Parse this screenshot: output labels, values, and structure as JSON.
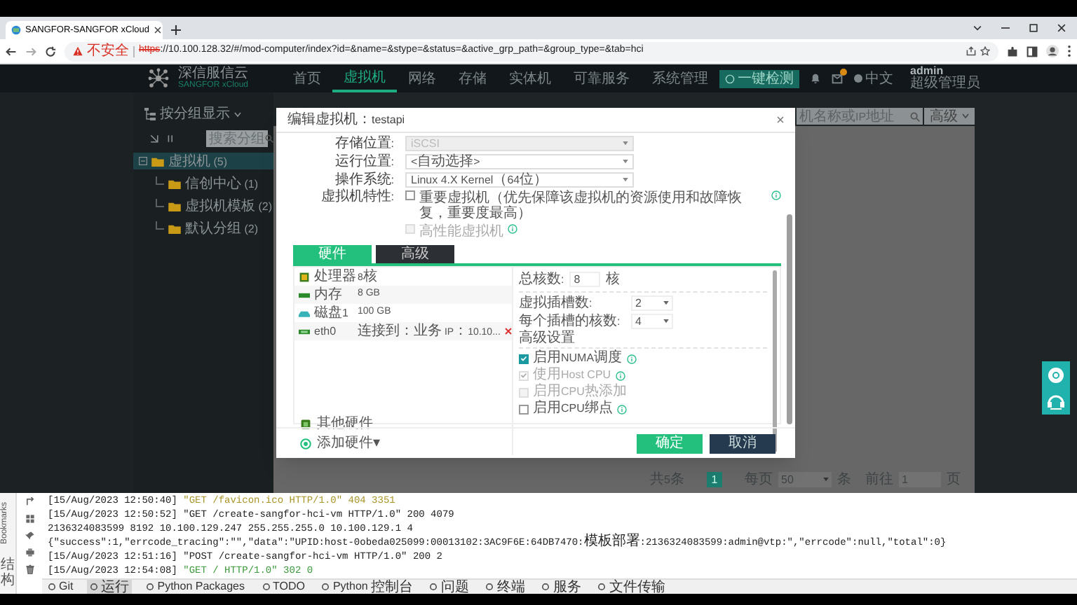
{
  "browser": {
    "tab_title": "SANGFOR-SANGFOR xCloud",
    "insecure_label": "不安全",
    "url_scheme": "https",
    "url_rest": "://10.100.128.32/#/mod-computer/index?id=&name=&stype=&status=&active_grp_path=&group_type=&tab=hci"
  },
  "header": {
    "brand": "深信服信云",
    "brand_sub": "SANGFOR xCloud",
    "nav": [
      {
        "label": "首页",
        "selected": false
      },
      {
        "label": "虚拟机",
        "selected": true
      },
      {
        "label": "网络",
        "selected": false
      },
      {
        "label": "存储",
        "selected": false
      },
      {
        "label": "实体机",
        "selected": false
      },
      {
        "label": "可靠服务",
        "selected": false
      },
      {
        "label": "系统管理",
        "selected": false
      }
    ],
    "check_button": "一键检测",
    "language": "中文",
    "user": "admin",
    "role": "超级管理员"
  },
  "sidebar": {
    "group_toggle": "按分组显示",
    "search_placeholder": "搜索分组",
    "tree": [
      {
        "label": "虚拟机 (5)",
        "selected": true,
        "expanded": true,
        "children": [
          {
            "label": "信创中心 (1)",
            "selected": false
          },
          {
            "label": "虚拟机模板 (2)",
            "selected": false
          },
          {
            "label": "默认分组 (2)",
            "selected": false
          }
        ]
      }
    ]
  },
  "toolbar": {
    "search_placeholder": "机名称或IP地址",
    "advanced": "高级"
  },
  "pagination": {
    "total": "共5条",
    "current": "1",
    "per_page_label": "每页",
    "per_page": "50",
    "per_page_unit": "条",
    "goto_label": "前往",
    "goto_value": "1",
    "goto_unit": "页"
  },
  "dialog": {
    "title": "编辑虚拟机：testapi",
    "fields": [
      {
        "label": "存储位置:",
        "value": "iSCSI",
        "disabled": true
      },
      {
        "label": "运行位置:",
        "value": "<自动选择>",
        "disabled": false
      },
      {
        "label": "操作系统:",
        "value": "Linux 4.X Kernel（64位）",
        "disabled": false
      }
    ],
    "features_label": "虚拟机特性:",
    "features": [
      {
        "label": "重要虚拟机（优先保障该虚拟机的资源使用和故障恢复，重要度最高）",
        "checked": false,
        "disabled": false,
        "info": true
      },
      {
        "label": "高性能虚拟机",
        "checked": false,
        "disabled": true,
        "info": true
      }
    ],
    "tabs": [
      {
        "label": "硬件",
        "selected": true
      },
      {
        "label": "高级",
        "selected": false
      }
    ],
    "hardware": [
      {
        "kind": "cpu",
        "name": "处理器",
        "value": "8核",
        "removable": false
      },
      {
        "kind": "memory",
        "name": "内存",
        "value": "8 GB",
        "removable": false
      },
      {
        "kind": "disk",
        "name": "磁盘1",
        "value": "100 GB",
        "removable": false
      },
      {
        "kind": "nic",
        "name": "eth0",
        "value": "连接到：业务 IP：10.10...",
        "removable": true
      }
    ],
    "extras": [
      {
        "kind": "other",
        "label": "其他硬件"
      },
      {
        "kind": "add",
        "label": "添加硬件▾"
      }
    ],
    "cpu": {
      "total_label": "总核数:",
      "total": "8",
      "total_unit": "核",
      "selects": [
        {
          "label": "虚拟插槽数:",
          "value": "2"
        },
        {
          "label": "每个插槽的核数:",
          "value": "4"
        }
      ],
      "advanced_title": "高级设置",
      "options": [
        {
          "label": "启用NUMA调度",
          "checked": true,
          "disabled": false,
          "info": true
        },
        {
          "label": "使用Host CPU",
          "checked": true,
          "disabled": true,
          "info": true
        },
        {
          "label": "启用CPU热添加",
          "checked": false,
          "disabled": true,
          "info": false
        },
        {
          "label": "启用CPU绑点",
          "checked": false,
          "disabled": false,
          "info": true
        }
      ]
    },
    "buttons": [
      {
        "label": "确定",
        "kind": "primary"
      },
      {
        "label": "取消",
        "kind": "secondary"
      }
    ]
  },
  "ide": {
    "side_tabs": [
      "Bookmarks",
      "结构"
    ],
    "lines": [
      {
        "time": "[15/Aug/2023 12:50:40]",
        "message": "\"GET /favicon.ico HTTP/1.0\" 404 3351",
        "kind": "warn"
      },
      {
        "time": "[15/Aug/2023 12:50:52]",
        "message": "\"GET /create-sangfor-hci-vm HTTP/1.0\" 200 4079",
        "kind": "plain"
      },
      {
        "message": "2136324083599 8192 10.100.129.247 255.255.255.0 10.100.129.1 4",
        "kind": "plain"
      },
      {
        "message": "{\"success\":1,\"errcode_tracing\":\"\",\"data\":\"UPID:host-0obeda025099:00013102:3AC9F6E:64DB7470:模板部署:2136324083599:admin@vtp:\",\"errcode\":null,\"total\":0}",
        "kind": "plain"
      },
      {
        "time": "[15/Aug/2023 12:51:16]",
        "message": "\"POST /create-sangfor-hci-vm HTTP/1.0\" 200 2",
        "kind": "plain"
      },
      {
        "time": "[15/Aug/2023 12:54:08]",
        "message": "\"GET / HTTP/1.0\" 302 0",
        "kind": "ok"
      }
    ],
    "tools": [
      {
        "label": "Git",
        "selected": false
      },
      {
        "label": "运行",
        "selected": true
      },
      {
        "label": "Python Packages",
        "selected": false
      },
      {
        "label": "TODO",
        "selected": false
      },
      {
        "label": "Python 控制台",
        "selected": false
      },
      {
        "label": "问题",
        "selected": false
      },
      {
        "label": "终端",
        "selected": false
      },
      {
        "label": "服务",
        "selected": false
      },
      {
        "label": "文件传输",
        "selected": false
      }
    ]
  }
}
